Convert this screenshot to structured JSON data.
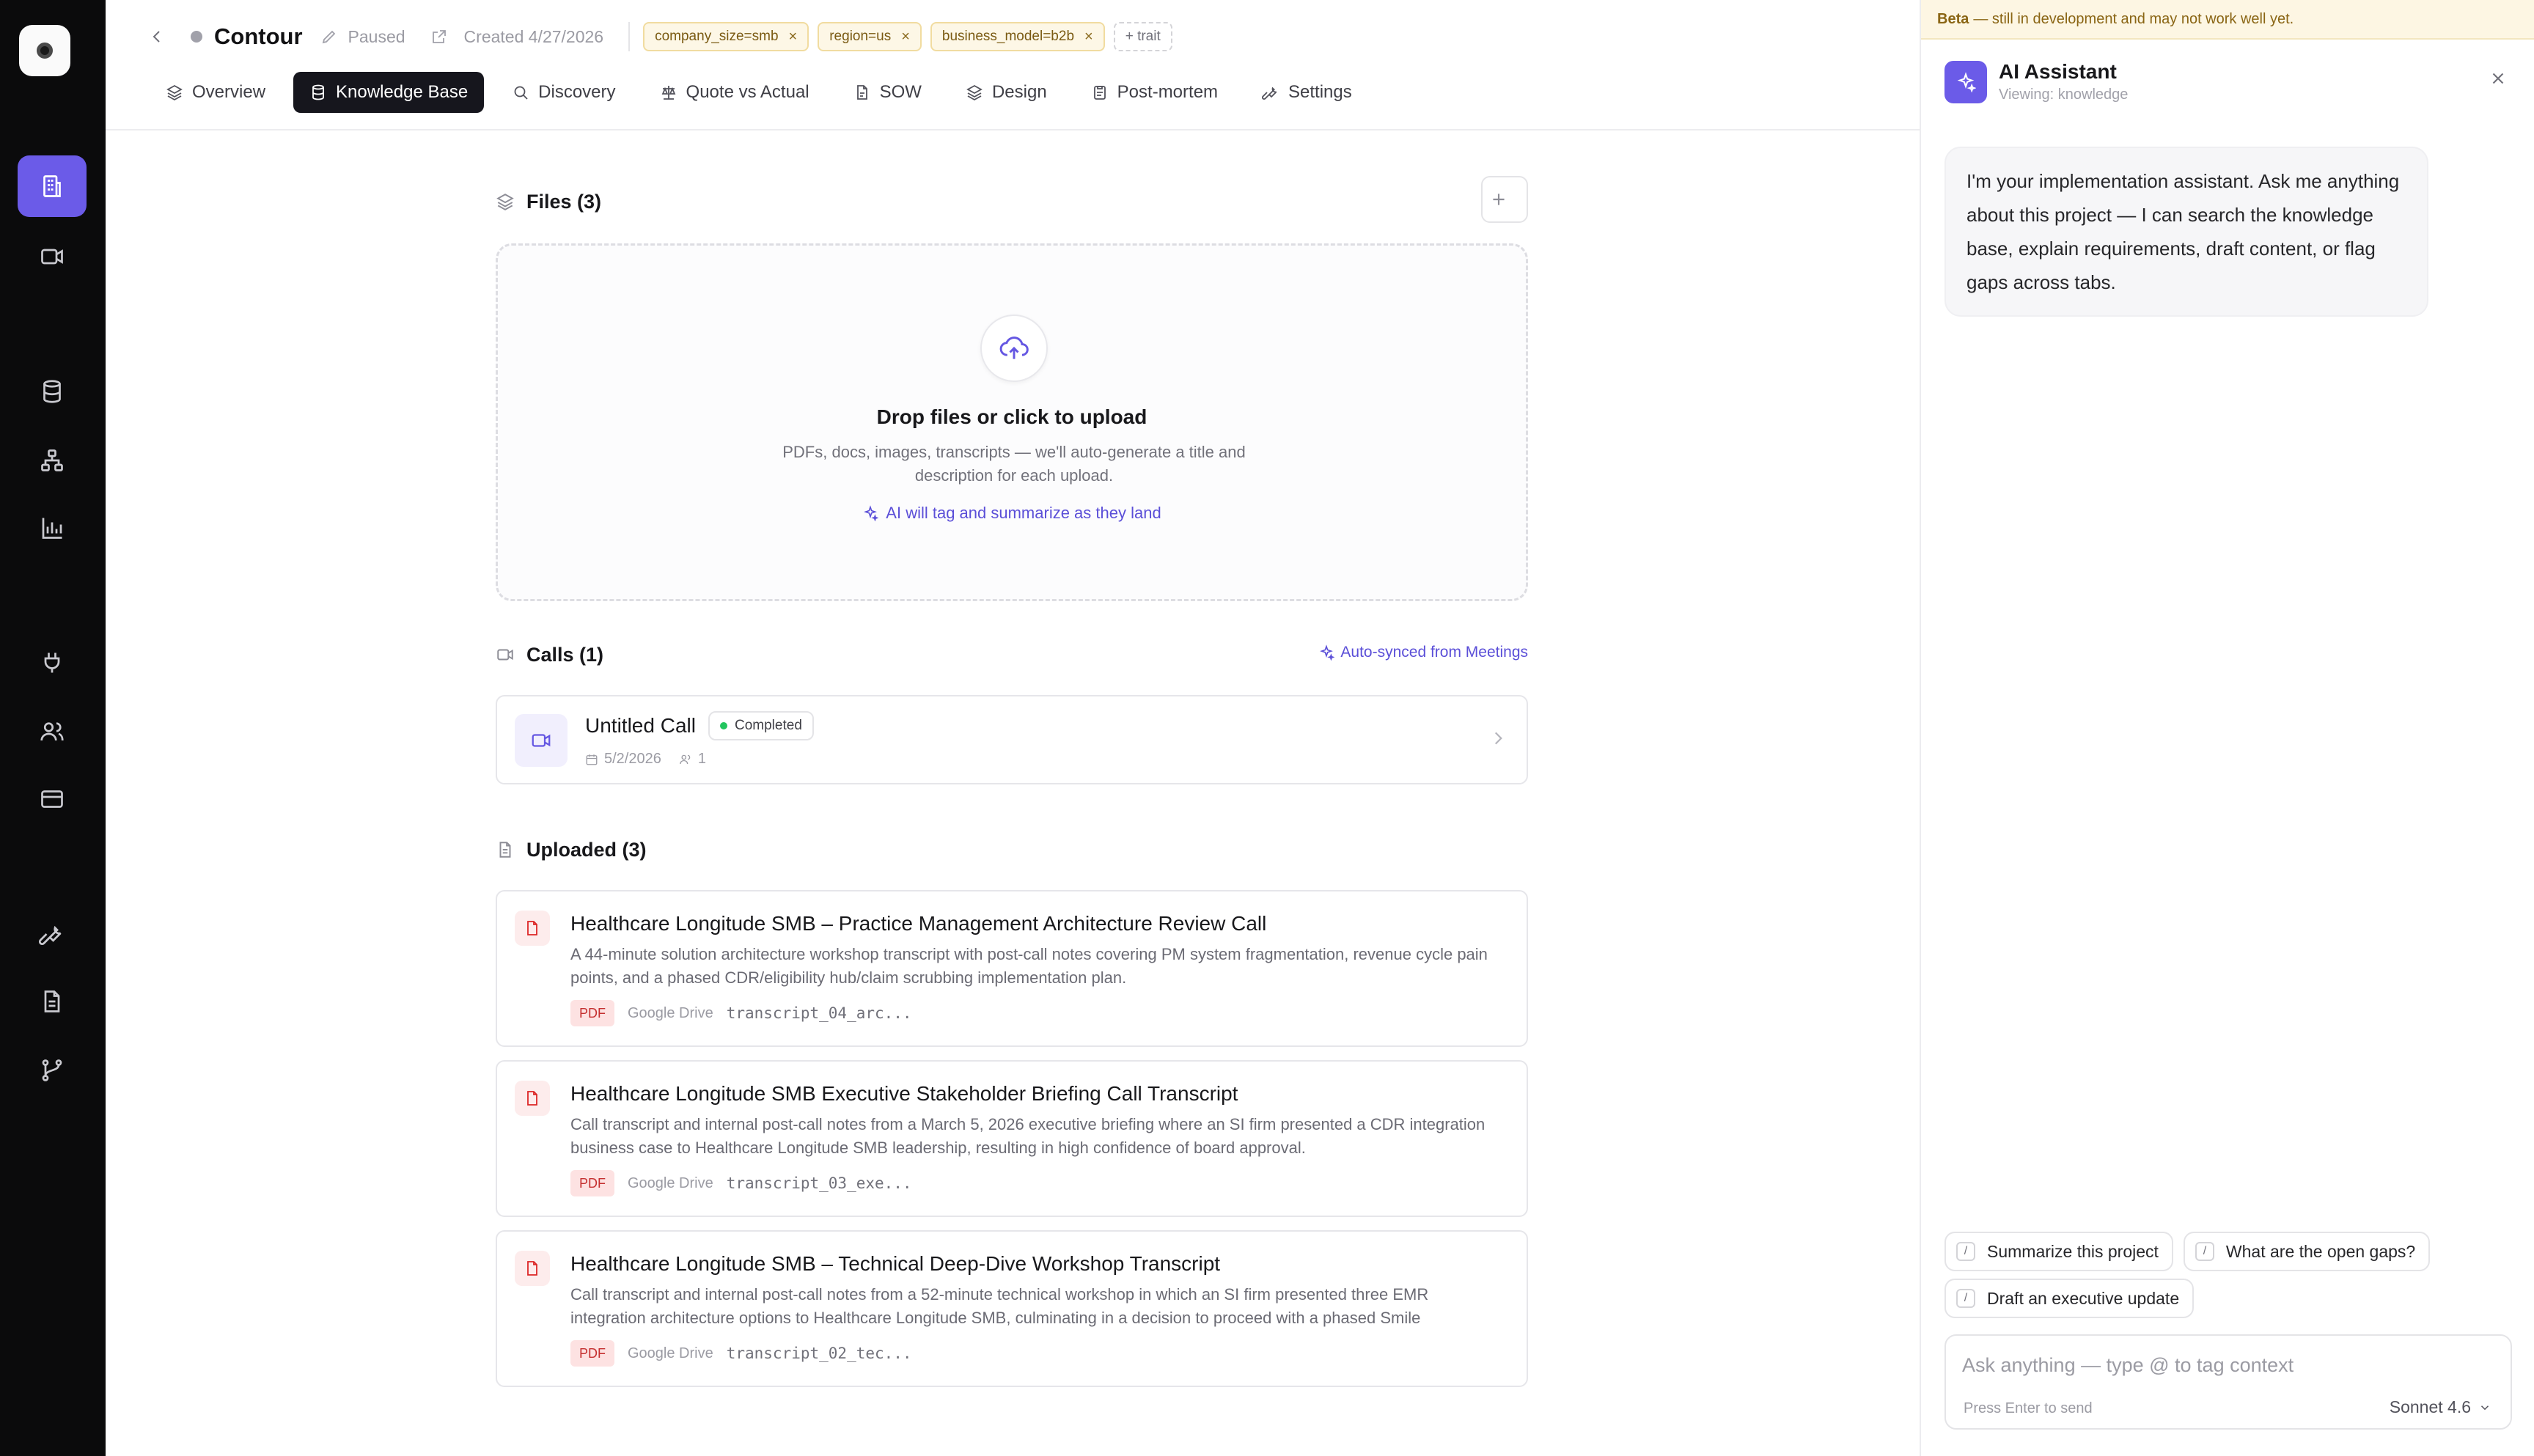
{
  "header": {
    "project_title": "Contour",
    "status": "Paused",
    "created": "Created 4/27/2026",
    "traits": [
      {
        "label": "company_size=smb"
      },
      {
        "label": "region=us"
      },
      {
        "label": "business_model=b2b"
      }
    ],
    "add_trait_label": "+ trait"
  },
  "tabs": [
    {
      "label": "Overview",
      "icon": "layers-icon"
    },
    {
      "label": "Knowledge Base",
      "icon": "database-icon",
      "active": true
    },
    {
      "label": "Discovery",
      "icon": "search-icon"
    },
    {
      "label": "Quote vs Actual",
      "icon": "scale-icon"
    },
    {
      "label": "SOW",
      "icon": "file-icon"
    },
    {
      "label": "Design",
      "icon": "layers-icon"
    },
    {
      "label": "Post-mortem",
      "icon": "clipboard-icon"
    },
    {
      "label": "Settings",
      "icon": "wrench-icon"
    }
  ],
  "files": {
    "title": "Files (3)",
    "dropzone": {
      "title": "Drop files or click to upload",
      "subtitle": "PDFs, docs, images, transcripts — we'll auto-generate a title and description for each upload.",
      "ai_note": "AI will tag and summarize as they land"
    }
  },
  "calls": {
    "title": "Calls (1)",
    "synced_label": "Auto-synced from Meetings",
    "items": [
      {
        "title": "Untitled Call",
        "status": "Completed",
        "date": "5/2/2026",
        "participants": "1"
      }
    ]
  },
  "uploaded": {
    "title": "Uploaded (3)",
    "items": [
      {
        "title": "Healthcare Longitude SMB – Practice Management Architecture Review Call",
        "description": "A 44-minute solution architecture workshop transcript with post-call notes covering PM system fragmentation, revenue cycle pain points, and a phased CDR/eligibility hub/claim scrubbing implementation plan.",
        "type": "PDF",
        "source": "Google Drive",
        "filename": "transcript_04_arc..."
      },
      {
        "title": "Healthcare Longitude SMB Executive Stakeholder Briefing Call Transcript",
        "description": "Call transcript and internal post-call notes from a March 5, 2026 executive briefing where an SI firm presented a CDR integration business case to Healthcare Longitude SMB leadership, resulting in high confidence of board approval.",
        "type": "PDF",
        "source": "Google Drive",
        "filename": "transcript_03_exe..."
      },
      {
        "title": "Healthcare Longitude SMB – Technical Deep-Dive Workshop Transcript",
        "description": "Call transcript and internal post-call notes from a 52-minute technical workshop in which an SI firm presented three EMR integration architecture options to Healthcare Longitude SMB, culminating in a decision to proceed with a phased Smile",
        "type": "PDF",
        "source": "Google Drive",
        "filename": "transcript_02_tec..."
      }
    ]
  },
  "assistant": {
    "beta_strong": "Beta",
    "beta_text": "— still in development and may not work well yet.",
    "title": "AI Assistant",
    "viewing": "Viewing: knowledge",
    "message": "I'm your implementation assistant. Ask me anything about this project — I can search the knowledge base, explain requirements, draft content, or flag gaps across tabs.",
    "suggestions": [
      "Summarize this project",
      "What are the open gaps?",
      "Draft an executive update"
    ],
    "slash": "/",
    "input_placeholder": "Ask anything — type @ to tag context",
    "hint": "Press Enter to send",
    "model": "Sonnet 4.6"
  },
  "colors": {
    "accent": "#6b5be8",
    "rail_bg": "#0b0b0c",
    "trait_bg": "#fdf7e6",
    "pdf_red": "#dc2626",
    "status_green": "#22c55e"
  }
}
